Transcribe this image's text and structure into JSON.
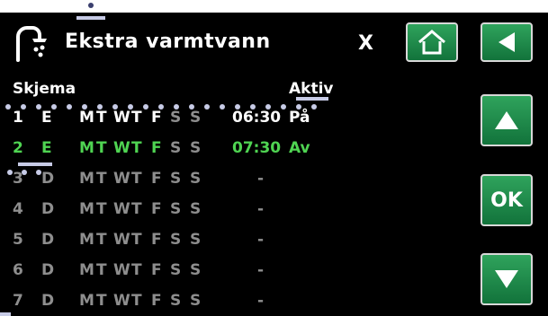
{
  "header": {
    "title": "Ekstra varmtvann",
    "close_label": "X"
  },
  "columns": {
    "schedule": "Skjema",
    "active": "Aktiv"
  },
  "schedules": [
    {
      "num": "1",
      "type": "E",
      "days": [
        "M",
        "T",
        "W",
        "T",
        "F",
        "S",
        "S"
      ],
      "time": "06:30",
      "state": "På",
      "style": "active-white"
    },
    {
      "num": "2",
      "type": "E",
      "days": [
        "M",
        "T",
        "W",
        "T",
        "F",
        "S",
        "S"
      ],
      "time": "07:30",
      "state": "Av",
      "style": "active-green"
    },
    {
      "num": "3",
      "type": "D",
      "days": [
        "M",
        "T",
        "W",
        "T",
        "F",
        "S",
        "S"
      ],
      "time": "-",
      "state": "",
      "style": "inactive"
    },
    {
      "num": "4",
      "type": "D",
      "days": [
        "M",
        "T",
        "W",
        "T",
        "F",
        "S",
        "S"
      ],
      "time": "-",
      "state": "",
      "style": "inactive"
    },
    {
      "num": "5",
      "type": "D",
      "days": [
        "M",
        "T",
        "W",
        "T",
        "F",
        "S",
        "S"
      ],
      "time": "-",
      "state": "",
      "style": "inactive"
    },
    {
      "num": "6",
      "type": "D",
      "days": [
        "M",
        "T",
        "W",
        "T",
        "F",
        "S",
        "S"
      ],
      "time": "-",
      "state": "",
      "style": "inactive"
    },
    {
      "num": "7",
      "type": "D",
      "days": [
        "M",
        "T",
        "W",
        "T",
        "F",
        "S",
        "S"
      ],
      "time": "-",
      "state": "",
      "style": "inactive"
    }
  ],
  "buttons": {
    "ok_label": "OK"
  },
  "icons": {
    "header": "hot-water-tap-icon",
    "home": "home-icon",
    "back": "back-arrow-icon",
    "up": "arrow-up-icon",
    "down": "arrow-down-icon"
  },
  "colors": {
    "button_green": "#1f8a4a",
    "selected_row": "#4fd452",
    "active_text": "#ffffff",
    "inactive_text": "#8e8e8e"
  }
}
